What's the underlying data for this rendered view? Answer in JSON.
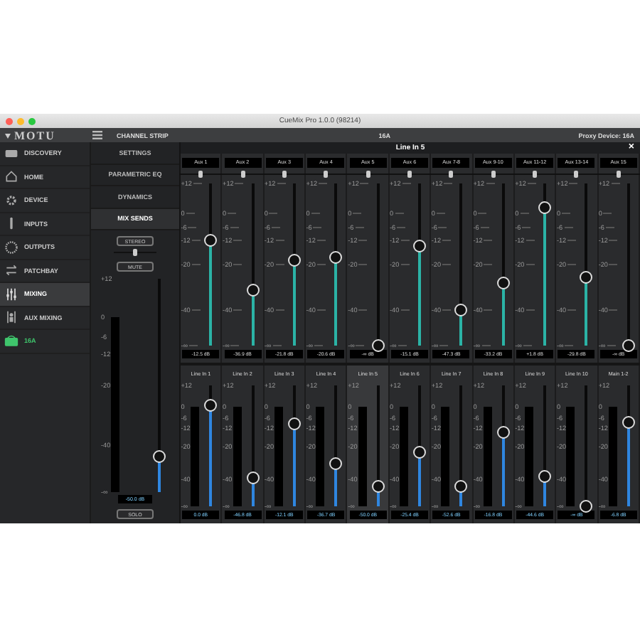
{
  "window": {
    "title": "CueMix Pro 1.0.0 (98214)"
  },
  "header": {
    "logo": "MOTU",
    "section": "CHANNEL STRIP",
    "device": "16A",
    "proxy": "Proxy Device: 16A"
  },
  "sidebar": {
    "items": [
      {
        "label": "DISCOVERY",
        "kind": "nav",
        "selected": false
      },
      {
        "label": "HOME",
        "kind": "nav",
        "selected": false
      },
      {
        "label": "DEVICE",
        "kind": "nav",
        "selected": false
      },
      {
        "label": "INPUTS",
        "kind": "nav",
        "selected": false
      },
      {
        "label": "OUTPUTS",
        "kind": "nav",
        "selected": false
      },
      {
        "label": "PATCHBAY",
        "kind": "nav",
        "selected": false
      },
      {
        "label": "MIXING",
        "kind": "nav",
        "selected": true
      },
      {
        "label": "AUX MIXING",
        "kind": "nav",
        "selected": false
      },
      {
        "label": "16A",
        "kind": "device",
        "selected": false
      }
    ]
  },
  "channel_strip": {
    "tabs": [
      {
        "label": "SETTINGS",
        "selected": false
      },
      {
        "label": "PARAMETRIC EQ",
        "selected": false
      },
      {
        "label": "DYNAMICS",
        "selected": false
      },
      {
        "label": "MIX SENDS",
        "selected": true
      }
    ],
    "stereo_button": "STEREO",
    "pan": {
      "level": 0.5
    },
    "mute_button": "MUTE",
    "scale": [
      "+12",
      "0",
      "-6",
      "-12",
      "-20",
      "-40",
      "-∞"
    ],
    "fader": {
      "level": 0.17
    },
    "value": "-50.0 dB",
    "solo_button": "SOLO"
  },
  "mix": {
    "title": "Line In 5",
    "close": "×",
    "aux_strips": [
      {
        "label": "Aux 1",
        "pan": {
          "level": 0.5
        },
        "scale": [
          "+12",
          "0",
          "-6",
          "-12",
          "-20",
          "-40",
          "-∞"
        ],
        "level": 0.65,
        "value": "-12.5 dB"
      },
      {
        "label": "Aux 2",
        "pan": {
          "level": 0.5
        },
        "scale": [
          "+12",
          "0",
          "-6",
          "-12",
          "-20",
          "-40",
          "-∞"
        ],
        "level": 0.34,
        "value": "-36.9 dB"
      },
      {
        "label": "Aux 3",
        "pan": {
          "level": 0.5
        },
        "scale": [
          "+12",
          "0",
          "-6",
          "-12",
          "-20",
          "-40",
          "-∞"
        ],
        "level": 0.53,
        "value": "-21.8 dB"
      },
      {
        "label": "Aux 4",
        "pan": {
          "level": 0.5
        },
        "scale": [
          "+12",
          "0",
          "-6",
          "-12",
          "-20",
          "-40",
          "-∞"
        ],
        "level": 0.54,
        "value": "-20.6 dB"
      },
      {
        "label": "Aux 5",
        "pan": {
          "level": 0.5
        },
        "scale": [
          "+12",
          "0",
          "-6",
          "-12",
          "-20",
          "-40",
          "-∞"
        ],
        "level": 0,
        "value": "-∞ dB"
      },
      {
        "label": "Aux 6",
        "pan": {
          "level": 0.5
        },
        "scale": [
          "+12",
          "0",
          "-6",
          "-12",
          "-20",
          "-40",
          "-∞"
        ],
        "level": 0.61,
        "value": "-15.1 dB"
      },
      {
        "label": "Aux 7-8",
        "pan": {
          "level": 0.5
        },
        "scale": [
          "+12",
          "0",
          "-6",
          "-12",
          "-20",
          "-40",
          "-∞"
        ],
        "level": 0.22,
        "value": "-47.3 dB"
      },
      {
        "label": "Aux 9-10",
        "pan": {
          "level": 0.5
        },
        "scale": [
          "+12",
          "0",
          "-6",
          "-12",
          "-20",
          "-40",
          "-∞"
        ],
        "level": 0.39,
        "value": "-33.2 dB"
      },
      {
        "label": "Aux 11-12",
        "pan": {
          "level": 0.5
        },
        "scale": [
          "+12",
          "0",
          "-6",
          "-12",
          "-20",
          "-40",
          "-∞"
        ],
        "level": 0.85,
        "value": "+1.8 dB"
      },
      {
        "label": "Aux 13-14",
        "pan": {
          "level": 0.5
        },
        "scale": [
          "+12",
          "0",
          "-6",
          "-12",
          "-20",
          "-40",
          "-∞"
        ],
        "level": 0.42,
        "value": "-29.8 dB"
      },
      {
        "label": "Aux 15",
        "pan": {
          "level": 0.5
        },
        "scale": [
          "+12",
          "0",
          "-6",
          "-12",
          "-20",
          "-40",
          "-∞"
        ],
        "level": 0,
        "value": "-∞ dB"
      }
    ],
    "input_strips": [
      {
        "label": "Line In 1",
        "selected": false,
        "scale": [
          "+12",
          "0",
          "-6",
          "-12",
          "-20",
          "-40",
          "-∞"
        ],
        "level": 0.83,
        "value": "0.0 dB"
      },
      {
        "label": "Line In 2",
        "selected": false,
        "scale": [
          "+12",
          "0",
          "-6",
          "-12",
          "-20",
          "-40",
          "-∞"
        ],
        "level": 0.23,
        "value": "-46.8 dB"
      },
      {
        "label": "Line In 3",
        "selected": false,
        "scale": [
          "+12",
          "0",
          "-6",
          "-12",
          "-20",
          "-40",
          "-∞"
        ],
        "level": 0.68,
        "value": "-12.1 dB"
      },
      {
        "label": "Line In 4",
        "selected": false,
        "scale": [
          "+12",
          "0",
          "-6",
          "-12",
          "-20",
          "-40",
          "-∞"
        ],
        "level": 0.35,
        "value": "-36.7 dB"
      },
      {
        "label": "Line In 5",
        "selected": true,
        "scale": [
          "+12",
          "0",
          "-6",
          "-12",
          "-20",
          "-40",
          "-∞"
        ],
        "level": 0.17,
        "value": "-50.0 dB"
      },
      {
        "label": "Line In 6",
        "selected": false,
        "scale": [
          "+12",
          "0",
          "-6",
          "-12",
          "-20",
          "-40",
          "-∞"
        ],
        "level": 0.45,
        "value": "-25.4 dB"
      },
      {
        "label": "Line In 7",
        "selected": false,
        "scale": [
          "+12",
          "0",
          "-6",
          "-12",
          "-20",
          "-40",
          "-∞"
        ],
        "level": 0.16,
        "value": "-52.6 dB"
      },
      {
        "label": "Line In 8",
        "selected": false,
        "scale": [
          "+12",
          "0",
          "-6",
          "-12",
          "-20",
          "-40",
          "-∞"
        ],
        "level": 0.61,
        "value": "-16.8 dB"
      },
      {
        "label": "Line In 9",
        "selected": false,
        "scale": [
          "+12",
          "0",
          "-6",
          "-12",
          "-20",
          "-40",
          "-∞"
        ],
        "level": 0.25,
        "value": "-44.6 dB"
      },
      {
        "label": "Line In 10",
        "selected": false,
        "scale": [
          "+12",
          "0",
          "-6",
          "-12",
          "-20",
          "-40",
          "-∞"
        ],
        "level": 0,
        "value": "-∞ dB"
      },
      {
        "label": "Main 1-2",
        "selected": false,
        "scale": [
          "+12",
          "0",
          "-6",
          "-12",
          "-20",
          "-40",
          "-∞"
        ],
        "level": 0.7,
        "value": "-6.8 dB"
      }
    ]
  }
}
